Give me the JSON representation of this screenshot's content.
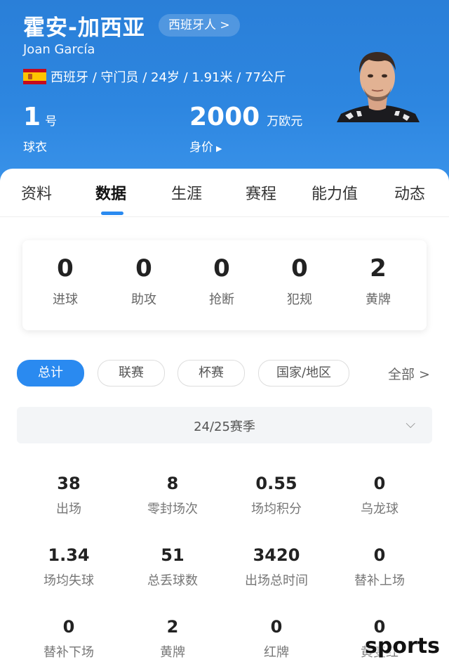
{
  "player": {
    "name_cn": "霍安-加西亚",
    "nationality_pill": "西班牙人 >",
    "name_en": "Joan García",
    "info": "西班牙 / 守门员 / 24岁 / 1.91米 / 77公斤",
    "jersey_number": "1",
    "jersey_unit": "号",
    "jersey_label": "球衣",
    "market_value": "2000",
    "market_value_unit": "万欧元",
    "market_value_label": "身价"
  },
  "tabs": [
    "资料",
    "数据",
    "生涯",
    "赛程",
    "能力值",
    "动态"
  ],
  "active_tab": "数据",
  "summary": [
    {
      "value": "0",
      "label": "进球"
    },
    {
      "value": "0",
      "label": "助攻"
    },
    {
      "value": "0",
      "label": "抢断"
    },
    {
      "value": "0",
      "label": "犯规"
    },
    {
      "value": "2",
      "label": "黄牌"
    }
  ],
  "filters": [
    "总计",
    "联赛",
    "杯赛",
    "国家/地区"
  ],
  "active_filter": "总计",
  "all_label": "全部 >",
  "season": "24/25赛季",
  "stats": [
    {
      "value": "38",
      "label": "出场"
    },
    {
      "value": "8",
      "label": "零封场次"
    },
    {
      "value": "0.55",
      "label": "场均积分"
    },
    {
      "value": "0",
      "label": "乌龙球"
    },
    {
      "value": "1.34",
      "label": "场均失球"
    },
    {
      "value": "51",
      "label": "总丢球数"
    },
    {
      "value": "3420",
      "label": "出场总时间"
    },
    {
      "value": "0",
      "label": "替补上场"
    },
    {
      "value": "0",
      "label": "替补下场"
    },
    {
      "value": "2",
      "label": "黄牌"
    },
    {
      "value": "0",
      "label": "红牌"
    },
    {
      "value": "0",
      "label": "黄变红"
    }
  ],
  "watermark": "sports",
  "colors": {
    "header": "#2d86e0",
    "accent": "#2a8af0",
    "flag_red": "#c60b1e",
    "flag_yellow": "#ffc400"
  }
}
